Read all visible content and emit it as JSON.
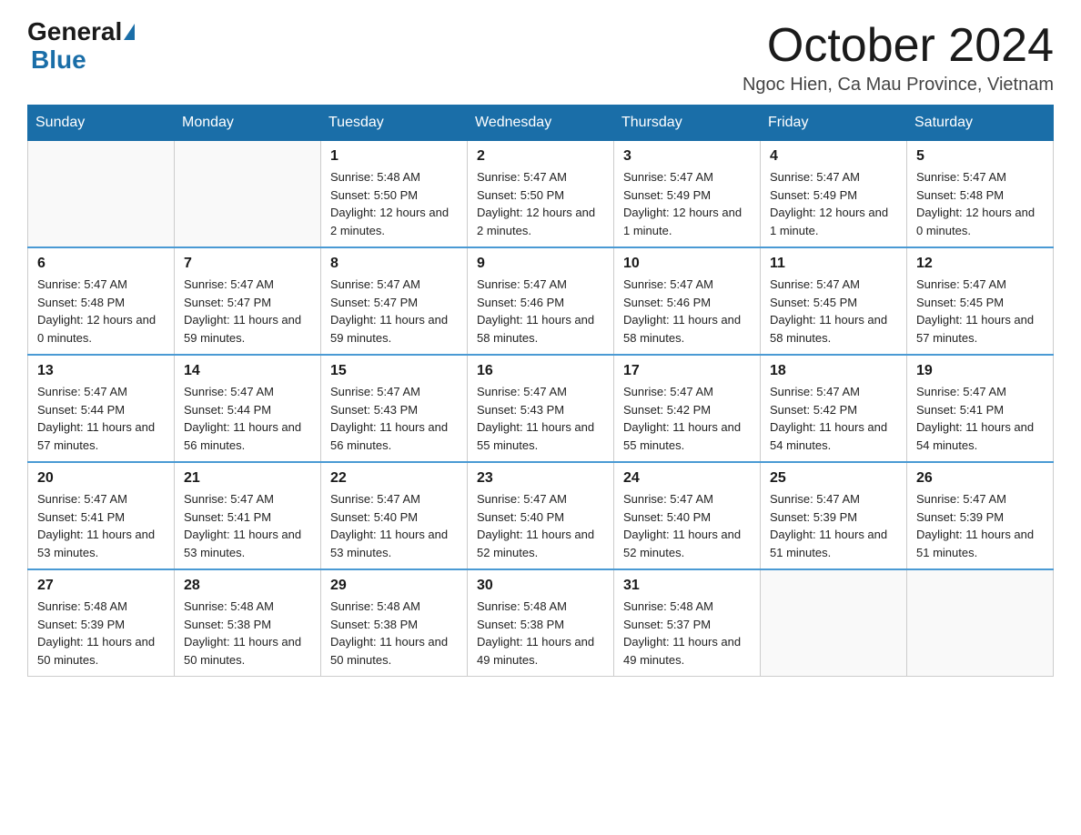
{
  "header": {
    "logo_general": "General",
    "logo_blue": "Blue",
    "month_title": "October 2024",
    "location": "Ngoc Hien, Ca Mau Province, Vietnam"
  },
  "days_of_week": [
    "Sunday",
    "Monday",
    "Tuesday",
    "Wednesday",
    "Thursday",
    "Friday",
    "Saturday"
  ],
  "weeks": [
    [
      {
        "day": "",
        "info": ""
      },
      {
        "day": "",
        "info": ""
      },
      {
        "day": "1",
        "info": "Sunrise: 5:48 AM\nSunset: 5:50 PM\nDaylight: 12 hours and 2 minutes."
      },
      {
        "day": "2",
        "info": "Sunrise: 5:47 AM\nSunset: 5:50 PM\nDaylight: 12 hours and 2 minutes."
      },
      {
        "day": "3",
        "info": "Sunrise: 5:47 AM\nSunset: 5:49 PM\nDaylight: 12 hours and 1 minute."
      },
      {
        "day": "4",
        "info": "Sunrise: 5:47 AM\nSunset: 5:49 PM\nDaylight: 12 hours and 1 minute."
      },
      {
        "day": "5",
        "info": "Sunrise: 5:47 AM\nSunset: 5:48 PM\nDaylight: 12 hours and 0 minutes."
      }
    ],
    [
      {
        "day": "6",
        "info": "Sunrise: 5:47 AM\nSunset: 5:48 PM\nDaylight: 12 hours and 0 minutes."
      },
      {
        "day": "7",
        "info": "Sunrise: 5:47 AM\nSunset: 5:47 PM\nDaylight: 11 hours and 59 minutes."
      },
      {
        "day": "8",
        "info": "Sunrise: 5:47 AM\nSunset: 5:47 PM\nDaylight: 11 hours and 59 minutes."
      },
      {
        "day": "9",
        "info": "Sunrise: 5:47 AM\nSunset: 5:46 PM\nDaylight: 11 hours and 58 minutes."
      },
      {
        "day": "10",
        "info": "Sunrise: 5:47 AM\nSunset: 5:46 PM\nDaylight: 11 hours and 58 minutes."
      },
      {
        "day": "11",
        "info": "Sunrise: 5:47 AM\nSunset: 5:45 PM\nDaylight: 11 hours and 58 minutes."
      },
      {
        "day": "12",
        "info": "Sunrise: 5:47 AM\nSunset: 5:45 PM\nDaylight: 11 hours and 57 minutes."
      }
    ],
    [
      {
        "day": "13",
        "info": "Sunrise: 5:47 AM\nSunset: 5:44 PM\nDaylight: 11 hours and 57 minutes."
      },
      {
        "day": "14",
        "info": "Sunrise: 5:47 AM\nSunset: 5:44 PM\nDaylight: 11 hours and 56 minutes."
      },
      {
        "day": "15",
        "info": "Sunrise: 5:47 AM\nSunset: 5:43 PM\nDaylight: 11 hours and 56 minutes."
      },
      {
        "day": "16",
        "info": "Sunrise: 5:47 AM\nSunset: 5:43 PM\nDaylight: 11 hours and 55 minutes."
      },
      {
        "day": "17",
        "info": "Sunrise: 5:47 AM\nSunset: 5:42 PM\nDaylight: 11 hours and 55 minutes."
      },
      {
        "day": "18",
        "info": "Sunrise: 5:47 AM\nSunset: 5:42 PM\nDaylight: 11 hours and 54 minutes."
      },
      {
        "day": "19",
        "info": "Sunrise: 5:47 AM\nSunset: 5:41 PM\nDaylight: 11 hours and 54 minutes."
      }
    ],
    [
      {
        "day": "20",
        "info": "Sunrise: 5:47 AM\nSunset: 5:41 PM\nDaylight: 11 hours and 53 minutes."
      },
      {
        "day": "21",
        "info": "Sunrise: 5:47 AM\nSunset: 5:41 PM\nDaylight: 11 hours and 53 minutes."
      },
      {
        "day": "22",
        "info": "Sunrise: 5:47 AM\nSunset: 5:40 PM\nDaylight: 11 hours and 53 minutes."
      },
      {
        "day": "23",
        "info": "Sunrise: 5:47 AM\nSunset: 5:40 PM\nDaylight: 11 hours and 52 minutes."
      },
      {
        "day": "24",
        "info": "Sunrise: 5:47 AM\nSunset: 5:40 PM\nDaylight: 11 hours and 52 minutes."
      },
      {
        "day": "25",
        "info": "Sunrise: 5:47 AM\nSunset: 5:39 PM\nDaylight: 11 hours and 51 minutes."
      },
      {
        "day": "26",
        "info": "Sunrise: 5:47 AM\nSunset: 5:39 PM\nDaylight: 11 hours and 51 minutes."
      }
    ],
    [
      {
        "day": "27",
        "info": "Sunrise: 5:48 AM\nSunset: 5:39 PM\nDaylight: 11 hours and 50 minutes."
      },
      {
        "day": "28",
        "info": "Sunrise: 5:48 AM\nSunset: 5:38 PM\nDaylight: 11 hours and 50 minutes."
      },
      {
        "day": "29",
        "info": "Sunrise: 5:48 AM\nSunset: 5:38 PM\nDaylight: 11 hours and 50 minutes."
      },
      {
        "day": "30",
        "info": "Sunrise: 5:48 AM\nSunset: 5:38 PM\nDaylight: 11 hours and 49 minutes."
      },
      {
        "day": "31",
        "info": "Sunrise: 5:48 AM\nSunset: 5:37 PM\nDaylight: 11 hours and 49 minutes."
      },
      {
        "day": "",
        "info": ""
      },
      {
        "day": "",
        "info": ""
      }
    ]
  ]
}
